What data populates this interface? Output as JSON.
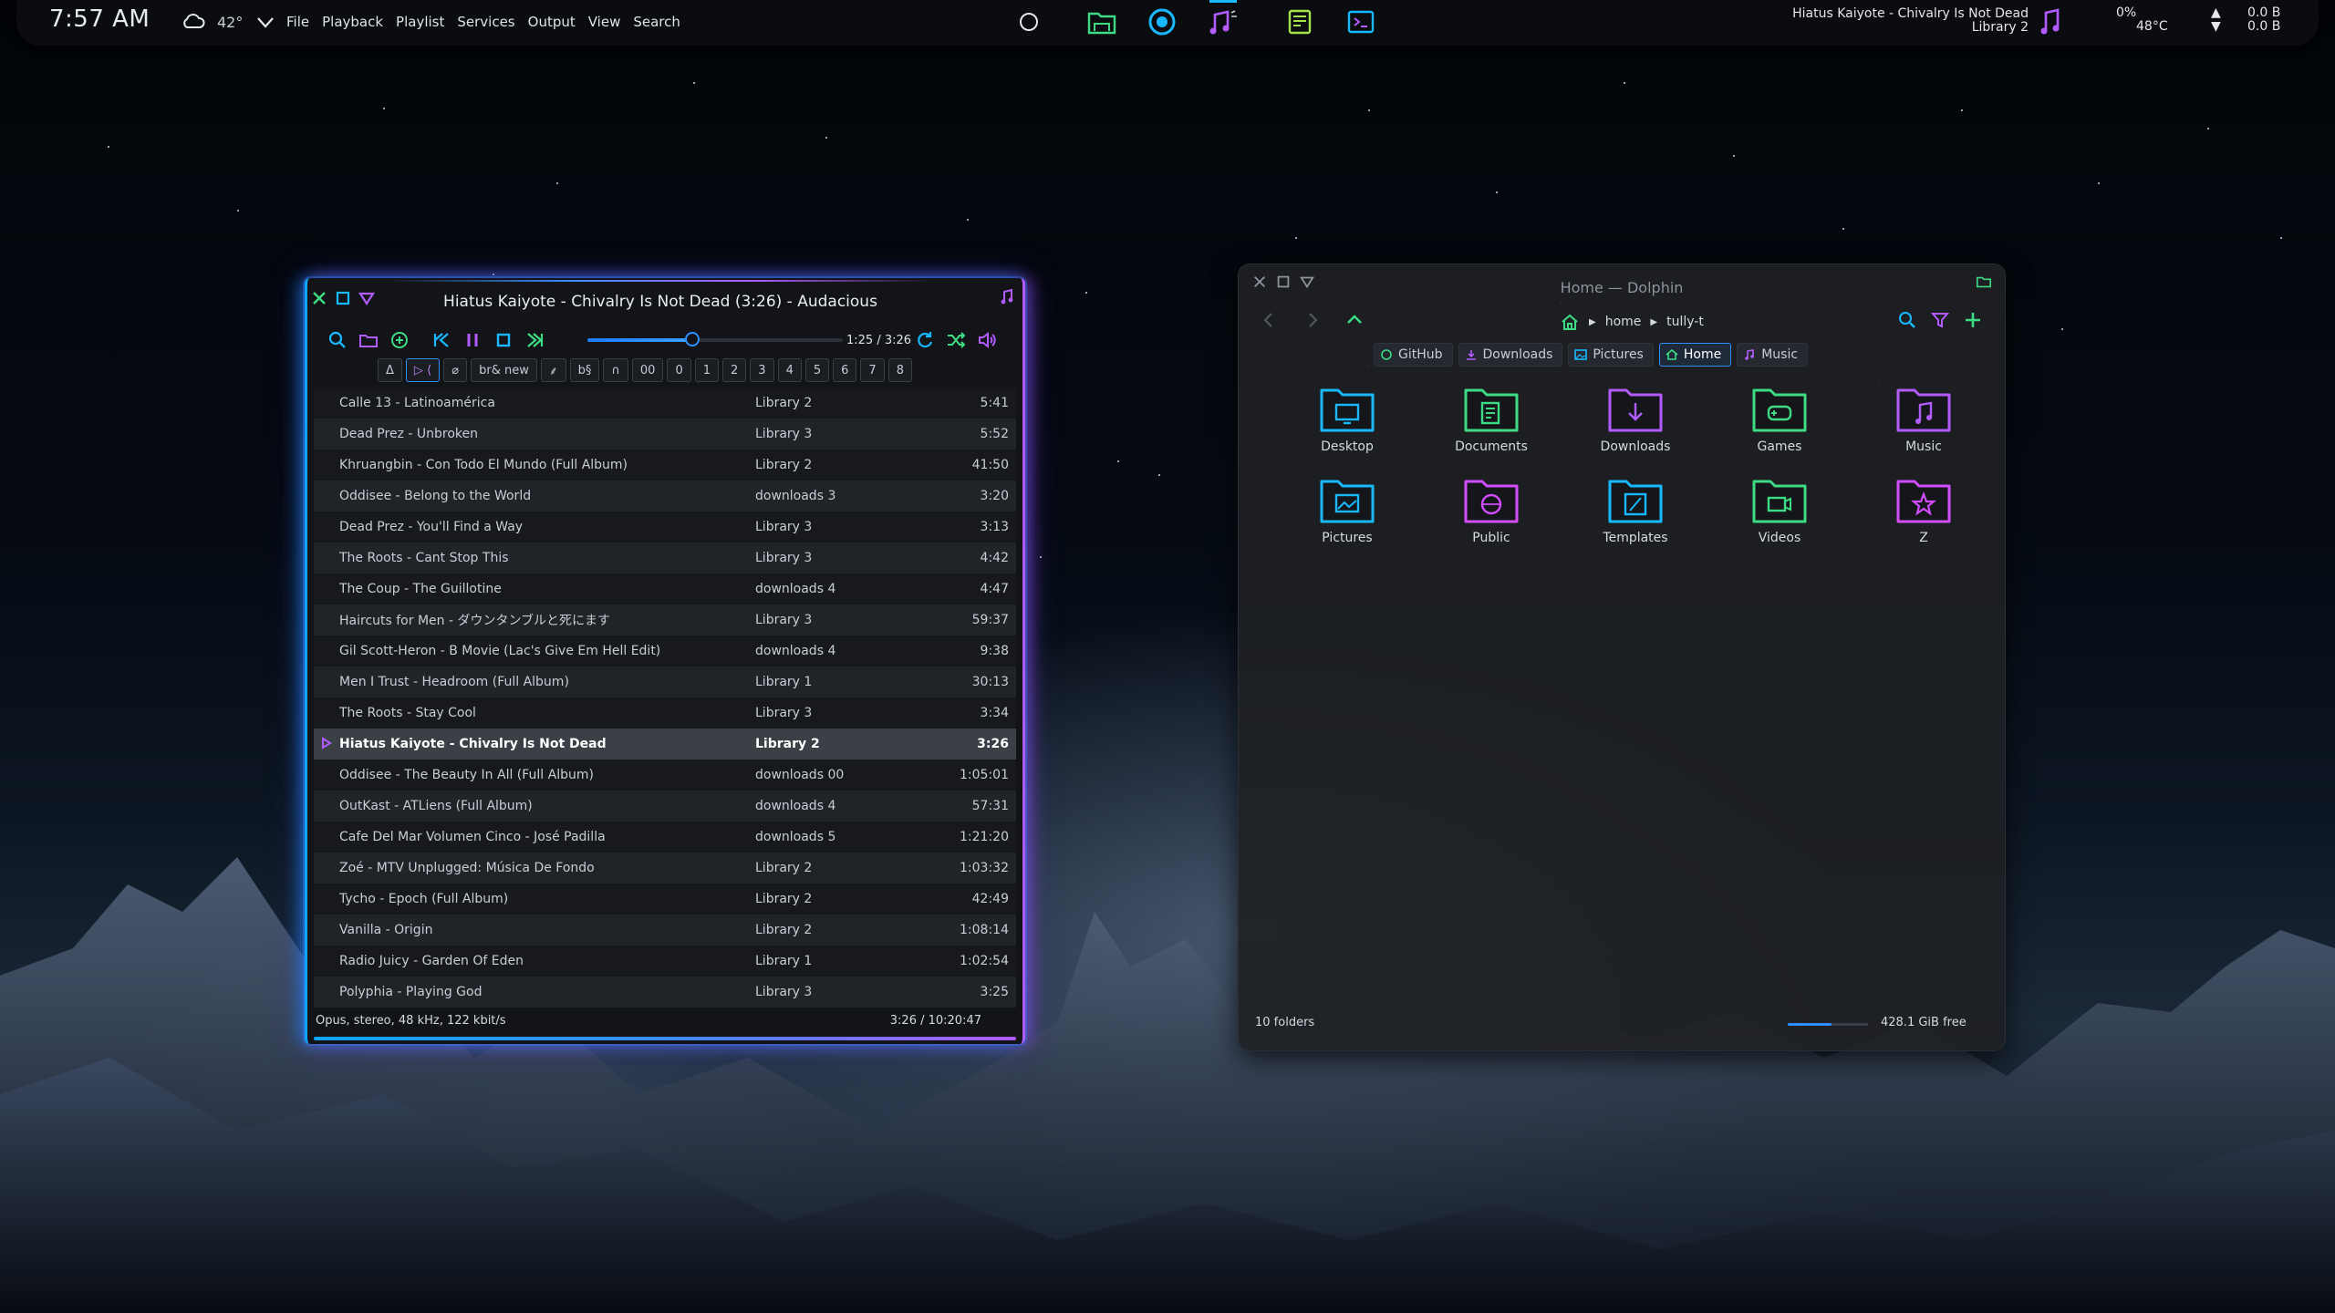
{
  "panel": {
    "clock": "7:57 AM",
    "temperature": "42°",
    "menu": [
      "File",
      "Playback",
      "Playlist",
      "Services",
      "Output",
      "View",
      "Search"
    ],
    "now_playing_title": "Hiatus Kaiyote - Chivalry Is Not Dead",
    "now_playing_album": "Library 2",
    "cpu_percent": "0%",
    "cpu_temp": "48°C",
    "net_up": "0.0 B",
    "net_down": "0.0 B",
    "task_icons": [
      "folder-icon",
      "browser-icon",
      "music-icon",
      "notes-icon",
      "terminal-icon"
    ],
    "colors": {
      "green": "#3ddc84",
      "cyan": "#19b9ff",
      "purple": "#b25cff"
    }
  },
  "audacious": {
    "title": "Hiatus Kaiyote - Chivalry Is Not Dead (3:26) - Audacious",
    "time": "1:25 / 3:26",
    "progress_fraction": 0.41,
    "tabs": [
      "Δ",
      "▷ ⟨",
      "⌀",
      "br& new",
      "⸙",
      "b§",
      "∩",
      "00",
      "0",
      "1",
      "2",
      "3",
      "4",
      "5",
      "6",
      "7",
      "8"
    ],
    "active_tab_index": 1,
    "playlist": [
      {
        "title": "Calle 13 - Latinoamérica",
        "album": "Library 2",
        "length": "5:41"
      },
      {
        "title": "Dead Prez - Unbroken",
        "album": "Library 3",
        "length": "5:52"
      },
      {
        "title": "Khruangbin - Con Todo El Mundo (Full Album)",
        "album": "Library 2",
        "length": "41:50"
      },
      {
        "title": "Oddisee - Belong to the World",
        "album": "downloads 3",
        "length": "3:20"
      },
      {
        "title": "Dead Prez - You'll Find a Way",
        "album": "Library 3",
        "length": "3:13"
      },
      {
        "title": "The Roots - Cant Stop This",
        "album": "Library 3",
        "length": "4:42"
      },
      {
        "title": "The Coup - The Guillotine",
        "album": "downloads 4",
        "length": "4:47"
      },
      {
        "title": "Haircuts for Men - ダウンタンブルと死にます",
        "album": "Library 3",
        "length": "59:37"
      },
      {
        "title": "Gil Scott-Heron - B Movie (Lac's Give Em Hell Edit)",
        "album": "downloads 4",
        "length": "9:38"
      },
      {
        "title": "Men I Trust - Headroom (Full Album)",
        "album": "Library 1",
        "length": "30:13"
      },
      {
        "title": "The Roots - Stay Cool",
        "album": "Library 3",
        "length": "3:34"
      },
      {
        "title": "Hiatus Kaiyote - Chivalry Is Not Dead",
        "album": "Library 2",
        "length": "3:26",
        "current": true
      },
      {
        "title": "Oddisee - The Beauty In All (Full Album)",
        "album": "downloads 00",
        "length": "1:05:01"
      },
      {
        "title": "OutKast - ATLiens (Full Album)",
        "album": "downloads 4",
        "length": "57:31"
      },
      {
        "title": "Cafe Del Mar Volumen Cinco - José Padilla",
        "album": "downloads 5",
        "length": "1:21:20"
      },
      {
        "title": "Zoé - MTV Unplugged: Música De Fondo",
        "album": "Library 2",
        "length": "1:03:32"
      },
      {
        "title": "Tycho - Epoch (Full Album)",
        "album": "Library 2",
        "length": "42:49"
      },
      {
        "title": "Vanilla - Origin",
        "album": "Library 2",
        "length": "1:08:14"
      },
      {
        "title": "Radio Juicy - Garden Of Eden",
        "album": "Library 1",
        "length": "1:02:54"
      },
      {
        "title": "Polyphia - Playing God",
        "album": "Library 3",
        "length": "3:25"
      }
    ],
    "status_left": "Opus, stereo, 48 kHz, 122 kbit/s",
    "status_right": "3:26 / 10:20:47"
  },
  "dolphin": {
    "title": "Home — Dolphin",
    "breadcrumb": [
      "home",
      "tully-t"
    ],
    "places": [
      {
        "label": "GitHub",
        "icon": "github-icon"
      },
      {
        "label": "Downloads",
        "icon": "download-icon"
      },
      {
        "label": "Pictures",
        "icon": "picture-icon"
      },
      {
        "label": "Home",
        "icon": "home-icon",
        "active": true
      },
      {
        "label": "Music",
        "icon": "music-icon"
      }
    ],
    "folders": [
      {
        "name": "Desktop",
        "color": "#19b9ff",
        "glyph": "desktop"
      },
      {
        "name": "Documents",
        "color": "#3ddc84",
        "glyph": "docs"
      },
      {
        "name": "Downloads",
        "color": "#b25cff",
        "glyph": "download"
      },
      {
        "name": "Games",
        "color": "#3ddc84",
        "glyph": "games"
      },
      {
        "name": "Music",
        "color": "#b25cff",
        "glyph": "music"
      },
      {
        "name": "Pictures",
        "color": "#19b9ff",
        "glyph": "picture"
      },
      {
        "name": "Public",
        "color": "#d24dff",
        "glyph": "public"
      },
      {
        "name": "Templates",
        "color": "#19b9ff",
        "glyph": "template"
      },
      {
        "name": "Videos",
        "color": "#3ddc84",
        "glyph": "video"
      },
      {
        "name": "Z",
        "color": "#d24dff",
        "glyph": "star"
      }
    ],
    "status_left": "10 folders",
    "free_space": "428.1 GiB free",
    "used_fraction": 0.55
  }
}
